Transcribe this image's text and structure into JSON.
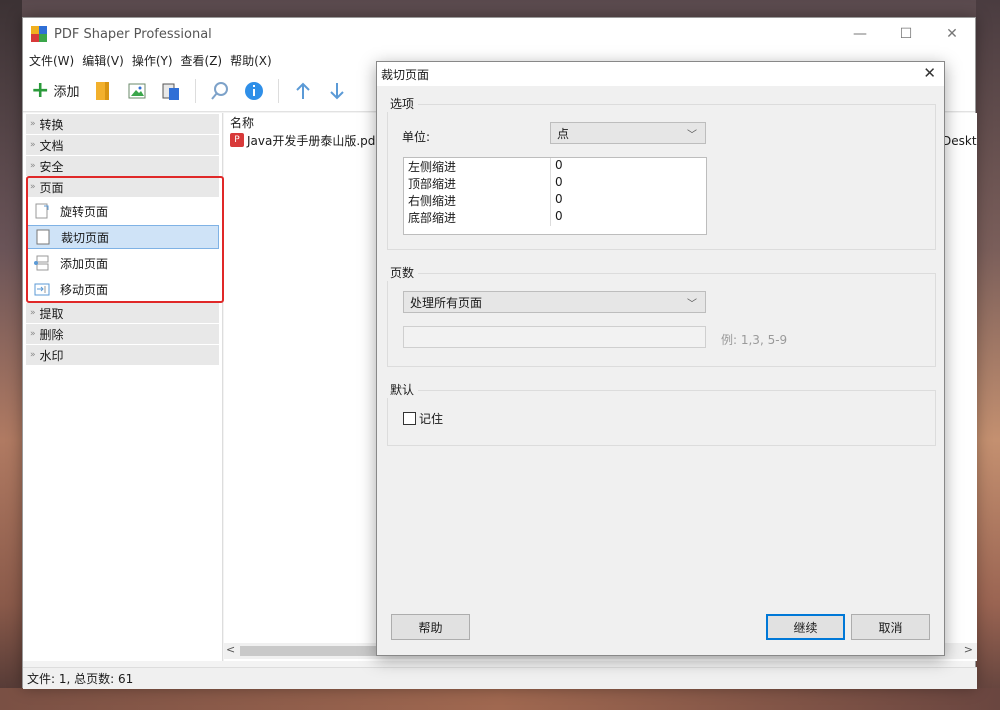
{
  "window": {
    "title": "PDF Shaper Professional",
    "controls": {
      "minimize": "—",
      "maximize": "☐",
      "close": "✕"
    }
  },
  "menu": [
    "文件(W)",
    "编辑(V)",
    "操作(Y)",
    "查看(Z)",
    "帮助(X)"
  ],
  "toolbar": {
    "add_label": "添加"
  },
  "sidebar": {
    "categories_top": [
      "转换",
      "文档",
      "安全",
      "页面"
    ],
    "page_items": [
      "旋转页面",
      "裁切页面",
      "添加页面",
      "移动页面"
    ],
    "categories_bottom": [
      "提取",
      "删除",
      "水印"
    ]
  },
  "list": {
    "header_name": "名称",
    "row_file": "Java开发手册泰山版.pd",
    "row_path_fragment": "Deskt"
  },
  "status": {
    "text": "文件: 1, 总页数: 61"
  },
  "dialog": {
    "title": "裁切页面",
    "options_group": "选项",
    "unit_label": "单位:",
    "unit_value": "点",
    "margins": [
      {
        "name": "左侧缩进",
        "value": "0"
      },
      {
        "name": "顶部缩进",
        "value": "0"
      },
      {
        "name": "右侧缩进",
        "value": "0"
      },
      {
        "name": "底部缩进",
        "value": "0"
      }
    ],
    "pages_group": "页数",
    "pages_value": "处理所有页面",
    "pages_hint": "例: 1,3, 5-9",
    "default_group": "默认",
    "remember_label": "记住",
    "help_button": "帮助",
    "continue_button": "继续",
    "cancel_button": "取消"
  }
}
